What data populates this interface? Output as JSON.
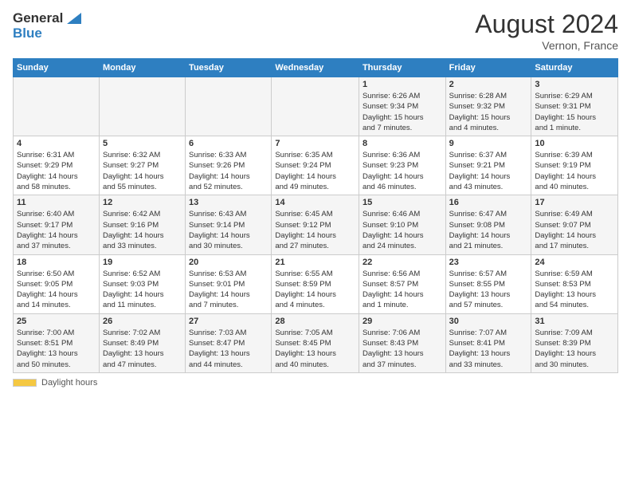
{
  "header": {
    "logo_general": "General",
    "logo_blue": "Blue",
    "month_year": "August 2024",
    "location": "Vernon, France"
  },
  "footer": {
    "daylight_label": "Daylight hours"
  },
  "weekdays": [
    "Sunday",
    "Monday",
    "Tuesday",
    "Wednesday",
    "Thursday",
    "Friday",
    "Saturday"
  ],
  "weeks": [
    [
      {
        "day": "",
        "info": ""
      },
      {
        "day": "",
        "info": ""
      },
      {
        "day": "",
        "info": ""
      },
      {
        "day": "",
        "info": ""
      },
      {
        "day": "1",
        "info": "Sunrise: 6:26 AM\nSunset: 9:34 PM\nDaylight: 15 hours\nand 7 minutes."
      },
      {
        "day": "2",
        "info": "Sunrise: 6:28 AM\nSunset: 9:32 PM\nDaylight: 15 hours\nand 4 minutes."
      },
      {
        "day": "3",
        "info": "Sunrise: 6:29 AM\nSunset: 9:31 PM\nDaylight: 15 hours\nand 1 minute."
      }
    ],
    [
      {
        "day": "4",
        "info": "Sunrise: 6:31 AM\nSunset: 9:29 PM\nDaylight: 14 hours\nand 58 minutes."
      },
      {
        "day": "5",
        "info": "Sunrise: 6:32 AM\nSunset: 9:27 PM\nDaylight: 14 hours\nand 55 minutes."
      },
      {
        "day": "6",
        "info": "Sunrise: 6:33 AM\nSunset: 9:26 PM\nDaylight: 14 hours\nand 52 minutes."
      },
      {
        "day": "7",
        "info": "Sunrise: 6:35 AM\nSunset: 9:24 PM\nDaylight: 14 hours\nand 49 minutes."
      },
      {
        "day": "8",
        "info": "Sunrise: 6:36 AM\nSunset: 9:23 PM\nDaylight: 14 hours\nand 46 minutes."
      },
      {
        "day": "9",
        "info": "Sunrise: 6:37 AM\nSunset: 9:21 PM\nDaylight: 14 hours\nand 43 minutes."
      },
      {
        "day": "10",
        "info": "Sunrise: 6:39 AM\nSunset: 9:19 PM\nDaylight: 14 hours\nand 40 minutes."
      }
    ],
    [
      {
        "day": "11",
        "info": "Sunrise: 6:40 AM\nSunset: 9:17 PM\nDaylight: 14 hours\nand 37 minutes."
      },
      {
        "day": "12",
        "info": "Sunrise: 6:42 AM\nSunset: 9:16 PM\nDaylight: 14 hours\nand 33 minutes."
      },
      {
        "day": "13",
        "info": "Sunrise: 6:43 AM\nSunset: 9:14 PM\nDaylight: 14 hours\nand 30 minutes."
      },
      {
        "day": "14",
        "info": "Sunrise: 6:45 AM\nSunset: 9:12 PM\nDaylight: 14 hours\nand 27 minutes."
      },
      {
        "day": "15",
        "info": "Sunrise: 6:46 AM\nSunset: 9:10 PM\nDaylight: 14 hours\nand 24 minutes."
      },
      {
        "day": "16",
        "info": "Sunrise: 6:47 AM\nSunset: 9:08 PM\nDaylight: 14 hours\nand 21 minutes."
      },
      {
        "day": "17",
        "info": "Sunrise: 6:49 AM\nSunset: 9:07 PM\nDaylight: 14 hours\nand 17 minutes."
      }
    ],
    [
      {
        "day": "18",
        "info": "Sunrise: 6:50 AM\nSunset: 9:05 PM\nDaylight: 14 hours\nand 14 minutes."
      },
      {
        "day": "19",
        "info": "Sunrise: 6:52 AM\nSunset: 9:03 PM\nDaylight: 14 hours\nand 11 minutes."
      },
      {
        "day": "20",
        "info": "Sunrise: 6:53 AM\nSunset: 9:01 PM\nDaylight: 14 hours\nand 7 minutes."
      },
      {
        "day": "21",
        "info": "Sunrise: 6:55 AM\nSunset: 8:59 PM\nDaylight: 14 hours\nand 4 minutes."
      },
      {
        "day": "22",
        "info": "Sunrise: 6:56 AM\nSunset: 8:57 PM\nDaylight: 14 hours\nand 1 minute."
      },
      {
        "day": "23",
        "info": "Sunrise: 6:57 AM\nSunset: 8:55 PM\nDaylight: 13 hours\nand 57 minutes."
      },
      {
        "day": "24",
        "info": "Sunrise: 6:59 AM\nSunset: 8:53 PM\nDaylight: 13 hours\nand 54 minutes."
      }
    ],
    [
      {
        "day": "25",
        "info": "Sunrise: 7:00 AM\nSunset: 8:51 PM\nDaylight: 13 hours\nand 50 minutes."
      },
      {
        "day": "26",
        "info": "Sunrise: 7:02 AM\nSunset: 8:49 PM\nDaylight: 13 hours\nand 47 minutes."
      },
      {
        "day": "27",
        "info": "Sunrise: 7:03 AM\nSunset: 8:47 PM\nDaylight: 13 hours\nand 44 minutes."
      },
      {
        "day": "28",
        "info": "Sunrise: 7:05 AM\nSunset: 8:45 PM\nDaylight: 13 hours\nand 40 minutes."
      },
      {
        "day": "29",
        "info": "Sunrise: 7:06 AM\nSunset: 8:43 PM\nDaylight: 13 hours\nand 37 minutes."
      },
      {
        "day": "30",
        "info": "Sunrise: 7:07 AM\nSunset: 8:41 PM\nDaylight: 13 hours\nand 33 minutes."
      },
      {
        "day": "31",
        "info": "Sunrise: 7:09 AM\nSunset: 8:39 PM\nDaylight: 13 hours\nand 30 minutes."
      }
    ]
  ]
}
